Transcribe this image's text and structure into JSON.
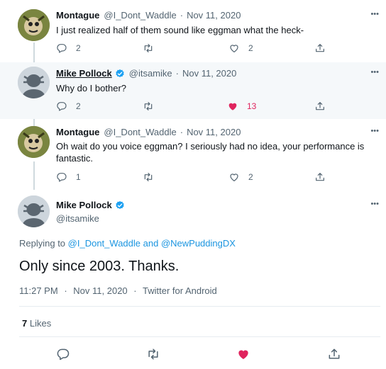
{
  "tweets": [
    {
      "name": "Montague",
      "handle": "@I_Dont_Waddle",
      "date": "Nov 11, 2020",
      "text": "I just realized half of them sound like eggman what the heck-",
      "replies": "2",
      "retweets": "",
      "likes": "2",
      "liked": false
    },
    {
      "name": "Mike Pollock",
      "handle": "@itsamike",
      "date": "Nov 11, 2020",
      "text": "Why do I bother?",
      "replies": "2",
      "retweets": "",
      "likes": "13",
      "liked": true,
      "verified": true
    },
    {
      "name": "Montague",
      "handle": "@I_Dont_Waddle",
      "date": "Nov 11, 2020",
      "text": "Oh wait do you voice eggman? I seriously had no idea, your performance is fantastic.",
      "replies": "1",
      "retweets": "",
      "likes": "2",
      "liked": false
    }
  ],
  "main_tweet": {
    "name": "Mike Pollock",
    "handle": "@itsamike",
    "verified": true,
    "replying_prefix": "Replying to",
    "replying_to_1": "@I_Dont_Waddle",
    "replying_and": "and",
    "replying_to_2": "@NewPuddingDX",
    "text": "Only since 2003. Thanks.",
    "time": "11:27 PM",
    "date": "Nov 11, 2020",
    "source": "Twitter for Android",
    "likes_count": "7",
    "likes_label": "Likes",
    "liked": true
  },
  "separator": "·",
  "more_glyph": "•••",
  "colors": {
    "like": "#e0245e",
    "link": "#1b95e0",
    "verified": "#1da1f2",
    "highlight_bg": "#f5f8fa",
    "muted": "#536471"
  },
  "icons": {
    "reply": "reply-icon",
    "retweet": "retweet-icon",
    "like": "heart-icon",
    "share": "share-icon",
    "more": "more-icon",
    "verified": "verified-badge-icon"
  }
}
